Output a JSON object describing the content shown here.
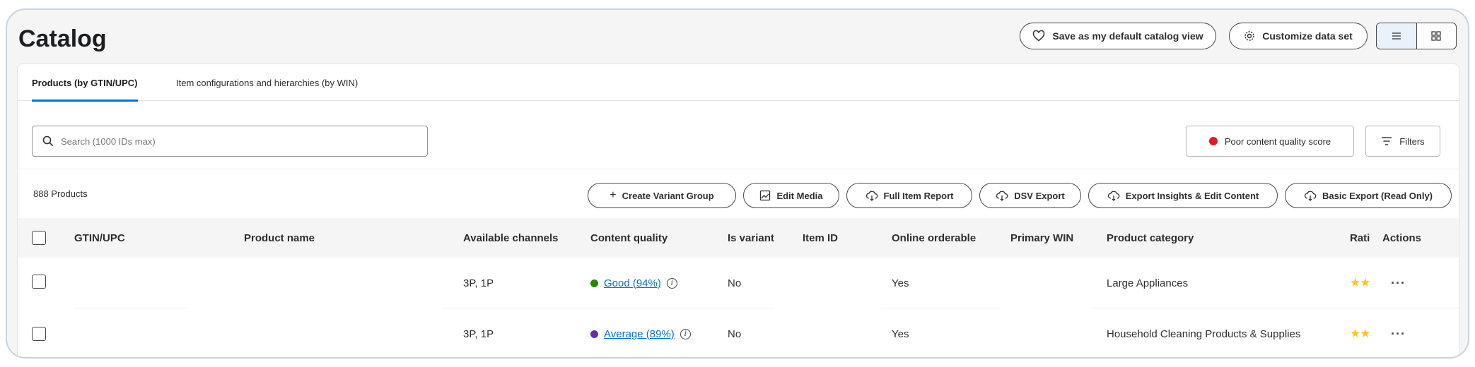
{
  "page": {
    "title": "Catalog"
  },
  "header_actions": {
    "save_default": "Save as my default catalog view",
    "customize": "Customize data set"
  },
  "tabs": [
    {
      "label": "Products (by GTIN/UPC)",
      "active": true
    },
    {
      "label": "Item configurations and hierarchies (by WIN)",
      "active": false
    }
  ],
  "search": {
    "placeholder": "Search (1000 IDs max)",
    "value": ""
  },
  "filters": {
    "poor_quality": "Poor content quality score",
    "filters": "Filters"
  },
  "product_count": "888 Products",
  "actions": {
    "create_variant_group": "Create Variant Group",
    "edit_media": "Edit Media",
    "full_item_report": "Full Item Report",
    "dsv_export": "DSV Export",
    "export_insights": "Export Insights & Edit Content",
    "basic_export": "Basic Export (Read Only)"
  },
  "table": {
    "columns": [
      "GTIN/UPC",
      "Product name",
      "Available channels",
      "Content quality",
      "Is variant",
      "Item ID",
      "Online orderable",
      "Primary WIN",
      "Product category",
      "Rati",
      "Actions"
    ],
    "rows": [
      {
        "gtin": "",
        "product_name": "",
        "channels": "3P, 1P",
        "quality_label": "Good (94%)",
        "quality_color": "#2a8703",
        "is_variant": "No",
        "item_id": "",
        "online_orderable": "Yes",
        "primary_win": "",
        "category": "Large Appliances",
        "rating_stars": 2,
        "actions": "···"
      },
      {
        "gtin": "",
        "product_name": "",
        "channels": "3P, 1P",
        "quality_label": "Average (89%)",
        "quality_color": "#6d2e98",
        "is_variant": "No",
        "item_id": "",
        "online_orderable": "Yes",
        "primary_win": "",
        "category": "Household Cleaning Products & Supplies",
        "rating_stars": 2,
        "actions": "···"
      }
    ]
  },
  "colors": {
    "accent": "#0071dc",
    "star": "#ffc220",
    "poor_dot": "#de1c24"
  }
}
